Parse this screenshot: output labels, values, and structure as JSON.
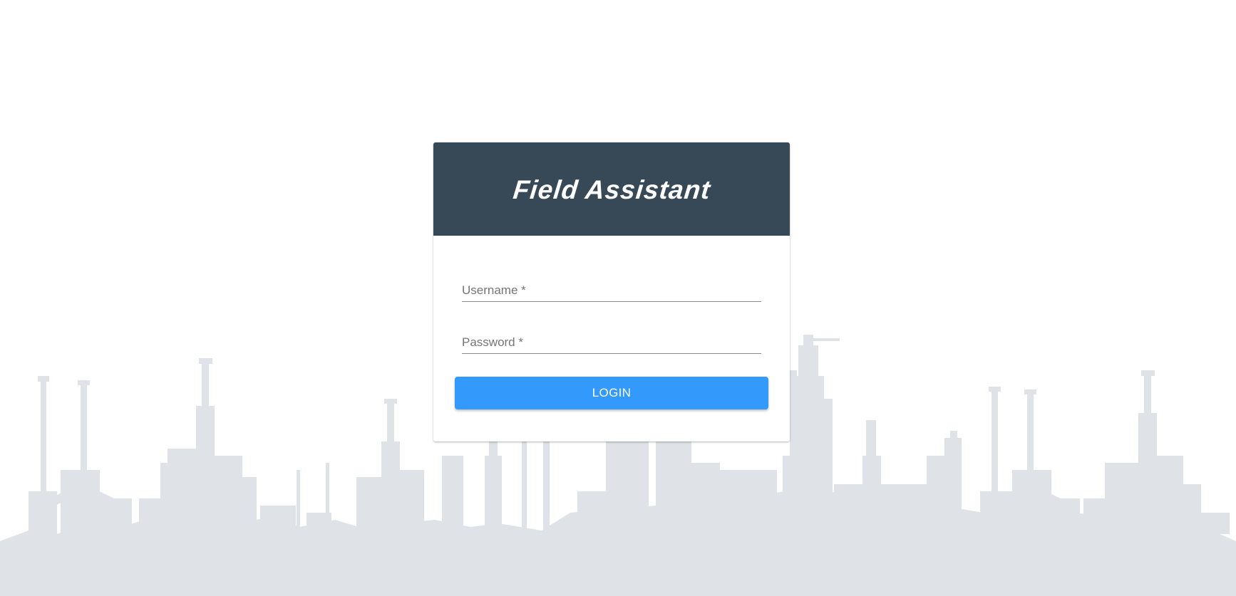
{
  "app": {
    "title": "Field Assistant"
  },
  "login_form": {
    "username": {
      "placeholder": "Username *",
      "value": ""
    },
    "password": {
      "placeholder": "Password *",
      "value": ""
    },
    "submit_label": "LOGIN"
  },
  "theme": {
    "header_color": "#374856",
    "button_color": "#3399fa",
    "skyline_color": "#dfe3e7"
  },
  "background": {
    "icon": "refinery-skyline-silhouette"
  }
}
